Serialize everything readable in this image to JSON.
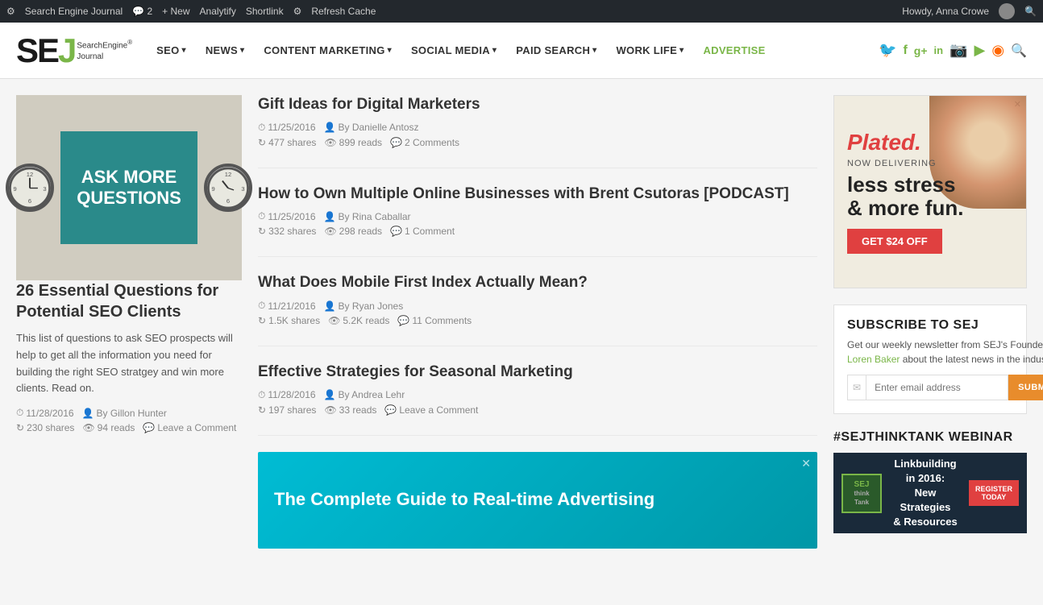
{
  "adminBar": {
    "siteIcon": "⚙",
    "siteName": "Search Engine Journal",
    "comments": "2",
    "new": "New",
    "analytify": "Analytify",
    "shortlink": "Shortlink",
    "pluginIcon": "⚙",
    "refreshCache": "Refresh Cache",
    "howdy": "Howdy, Anna Crowe"
  },
  "nav": {
    "logo": {
      "sef": "SE",
      "j": "J",
      "line1": "SearchEngine",
      "line2": "Journal",
      "reg": "®"
    },
    "items": [
      {
        "label": "SEO",
        "id": "seo"
      },
      {
        "label": "NEWS",
        "id": "news"
      },
      {
        "label": "CONTENT MARKETING",
        "id": "content-marketing"
      },
      {
        "label": "SOCIAL MEDIA",
        "id": "social-media"
      },
      {
        "label": "PAID SEARCH",
        "id": "paid-search"
      },
      {
        "label": "WORK LIFE",
        "id": "work-life"
      },
      {
        "label": "ADVERTISE",
        "id": "advertise"
      }
    ]
  },
  "featured": {
    "imageAlt": "Ask More Questions",
    "imageText": "ASK MORE QUESTIONS",
    "title": "26 Essential Questions for Potential SEO Clients",
    "excerpt": "This list of questions to ask SEO prospects will help to get all the information you need for building the right SEO stratgey and win more clients. Read on.",
    "date": "11/28/2016",
    "author": "By Gillon Hunter",
    "shares": "230 shares",
    "reads": "94 reads",
    "comment": "Leave a Comment"
  },
  "articles": [
    {
      "title": "Gift Ideas for Digital Marketers",
      "date": "11/25/2016",
      "author": "By Danielle Antosz",
      "shares": "477 shares",
      "reads": "899 reads",
      "comments": "2 Comments"
    },
    {
      "title": "How to Own Multiple Online Businesses with Brent Csutoras [PODCAST]",
      "date": "11/25/2016",
      "author": "By Rina Caballar",
      "shares": "332 shares",
      "reads": "298 reads",
      "comments": "1 Comment"
    },
    {
      "title": "What Does Mobile First Index Actually Mean?",
      "date": "11/21/2016",
      "author": "By Ryan Jones",
      "shares": "1.5K shares",
      "reads": "5.2K reads",
      "comments": "11 Comments"
    },
    {
      "title": "Effective Strategies for Seasonal Marketing",
      "date": "11/28/2016",
      "author": "By Andrea Lehr",
      "shares": "197 shares",
      "reads": "33 reads",
      "comments": "Leave a Comment"
    }
  ],
  "adMid": {
    "text": "The Complete Guide to Real-time Advertising"
  },
  "adPlated": {
    "brand": "Plated.",
    "sub": "NOW DELIVERING",
    "main": "less stress\n& more fun.",
    "cta": "GET $24 OFF"
  },
  "subscribe": {
    "title": "SUBSCRIBE TO SEJ",
    "desc": "Get our weekly newsletter from SEJ's Founder ",
    "link": "Loren Baker",
    "descEnd": " about the latest news in the industry!",
    "placeholder": "Enter email address",
    "submit": "SUBMIT"
  },
  "webinar": {
    "title": "#SEJTHINKTANK WEBINAR",
    "imageText": "Linkbuilding in 2016:\nNew Strategies\n& Resources",
    "registerBtn": "REGISTER TODAY"
  },
  "icons": {
    "twitter": "🐦",
    "facebook": "f",
    "googleplus": "g+",
    "linkedin": "in",
    "instagram": "📷",
    "youtube": "▶",
    "rss": "◉",
    "search": "🔍"
  }
}
